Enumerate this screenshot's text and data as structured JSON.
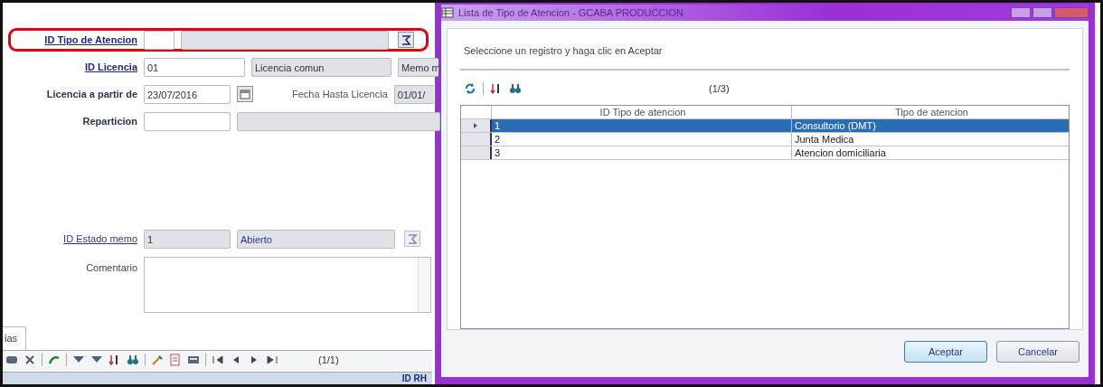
{
  "form": {
    "rows": [
      {
        "label": "ID Tipo de Atencion",
        "kind": "link-bold",
        "highlighted": true,
        "inputs": [
          {
            "kind": "edit"
          },
          {
            "kind": "readonly"
          },
          {
            "kind": "lookup"
          }
        ]
      },
      {
        "label": "ID Licencia",
        "kind": "link-bold",
        "highlighted": false,
        "inputs": [
          {
            "kind": "edit",
            "value": "01"
          },
          {
            "kind": "readonly",
            "value": "Licencia comun"
          },
          {
            "kind": "readonly",
            "value": "Memo m"
          }
        ]
      },
      {
        "label": "Licencia a partir de",
        "kind": "bold",
        "highlighted": false,
        "inputs": [
          {
            "kind": "edit",
            "value": "23/07/2016"
          },
          {
            "kind": "date"
          },
          {
            "kind": "caption",
            "value": "Fecha Hasta Licencia"
          },
          {
            "kind": "readonly",
            "value": "01/01/"
          }
        ]
      },
      {
        "label": "Reparticion",
        "kind": "bold",
        "highlighted": false,
        "inputs": [
          {
            "kind": "edit"
          },
          {
            "kind": "readonly"
          }
        ]
      },
      {
        "label": "ID Estado memo",
        "kind": "link",
        "highlighted": false,
        "inputs": [
          {
            "kind": "readonly",
            "value": "1"
          },
          {
            "kind": "readonly-blue",
            "value": "Abierto"
          },
          {
            "kind": "lookup-disabled"
          }
        ]
      },
      {
        "label": "Comentario",
        "kind": "plain",
        "highlighted": false,
        "inputs": [
          {
            "kind": "memo"
          }
        ]
      }
    ],
    "tab": "ias",
    "toolbar_counter": "(1/1)",
    "status_text": "ID RH"
  },
  "dialog": {
    "title": "Lista de Tipo de Atencion - GCABA PRODUCCION",
    "instruction": "Seleccione un registro y haga clic en Aceptar",
    "counter": "(1/3)",
    "columns": [
      "ID Tipo de atencion",
      "Tipo de atencion"
    ],
    "rows": [
      {
        "id": "1",
        "tipo": "Consultorio (DMT)",
        "selected": true
      },
      {
        "id": "2",
        "tipo": "Junta Medica",
        "selected": false
      },
      {
        "id": "3",
        "tipo": "Atencion domiciliaria",
        "selected": false
      }
    ],
    "buttons": [
      "Aceptar",
      "Cancelar"
    ]
  }
}
